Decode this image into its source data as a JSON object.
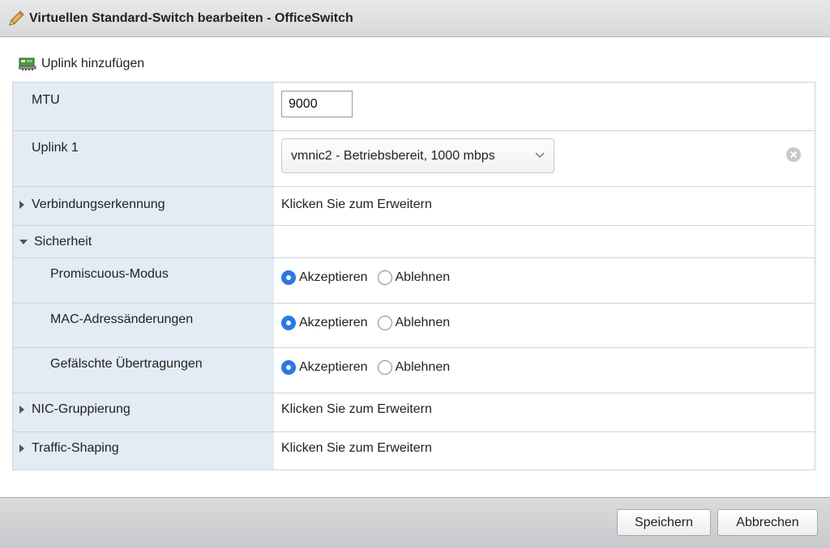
{
  "dialog": {
    "title": "Virtuellen Standard-Switch bearbeiten - OfficeSwitch",
    "title_icon": "pencil-icon"
  },
  "toolbar": {
    "add_uplink_label": "Uplink hinzufügen",
    "add_uplink_icon": "network-adapter-icon"
  },
  "form": {
    "mtu": {
      "label": "MTU",
      "value": "9000"
    },
    "uplink1": {
      "label": "Uplink 1",
      "selected": "vmnic2 - Betriebsbereit, 1000 mbps",
      "remove_icon": "remove-circle-icon"
    },
    "link_discovery": {
      "label": "Verbindungserkennung",
      "value": "Klicken Sie zum Erweitern",
      "expanded": false
    },
    "security": {
      "label": "Sicherheit",
      "expanded": true,
      "options": [
        {
          "label": "Promiscuous-Modus",
          "accept": "Akzeptieren",
          "reject": "Ablehnen",
          "selected": "accept"
        },
        {
          "label": "MAC-Adressänderungen",
          "accept": "Akzeptieren",
          "reject": "Ablehnen",
          "selected": "accept"
        },
        {
          "label": "Gefälschte Übertragungen",
          "accept": "Akzeptieren",
          "reject": "Ablehnen",
          "selected": "accept"
        }
      ]
    },
    "nic_teaming": {
      "label": "NIC-Gruppierung",
      "value": "Klicken Sie zum Erweitern",
      "expanded": false
    },
    "traffic_shaping": {
      "label": "Traffic-Shaping",
      "value": "Klicken Sie zum Erweitern",
      "expanded": false
    }
  },
  "footer": {
    "save_label": "Speichern",
    "cancel_label": "Abbrechen"
  },
  "colors": {
    "label_column_bg": "#e3ebf4",
    "radio_selected": "#2a78e4",
    "grid_border": "#cfd3d8"
  }
}
